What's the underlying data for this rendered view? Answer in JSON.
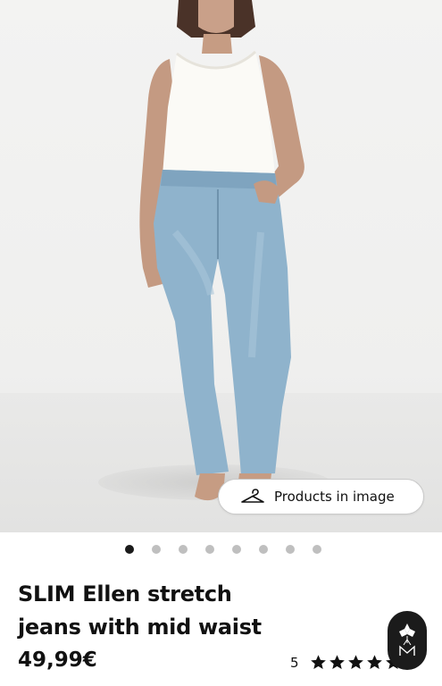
{
  "product": {
    "title": "SLIM Ellen stretch jeans with mid waist",
    "price": "49,99€",
    "rating_score": "5",
    "stars_filled": 5,
    "rating_count": ")"
  },
  "gallery": {
    "products_button_label": "Products in image",
    "image_count": 8,
    "active_index": 0
  },
  "colors": {
    "denim": "#8fb3cc",
    "tank": "#fbfaf6",
    "skin": "#c69c83",
    "hair": "#4a3228",
    "dot_active": "#1a1a1a",
    "dot_inactive": "#bfbfbf"
  },
  "icons": {
    "products_button": "hanger-icon",
    "rating": "star-icon",
    "floating": "brand-logo-icon"
  }
}
